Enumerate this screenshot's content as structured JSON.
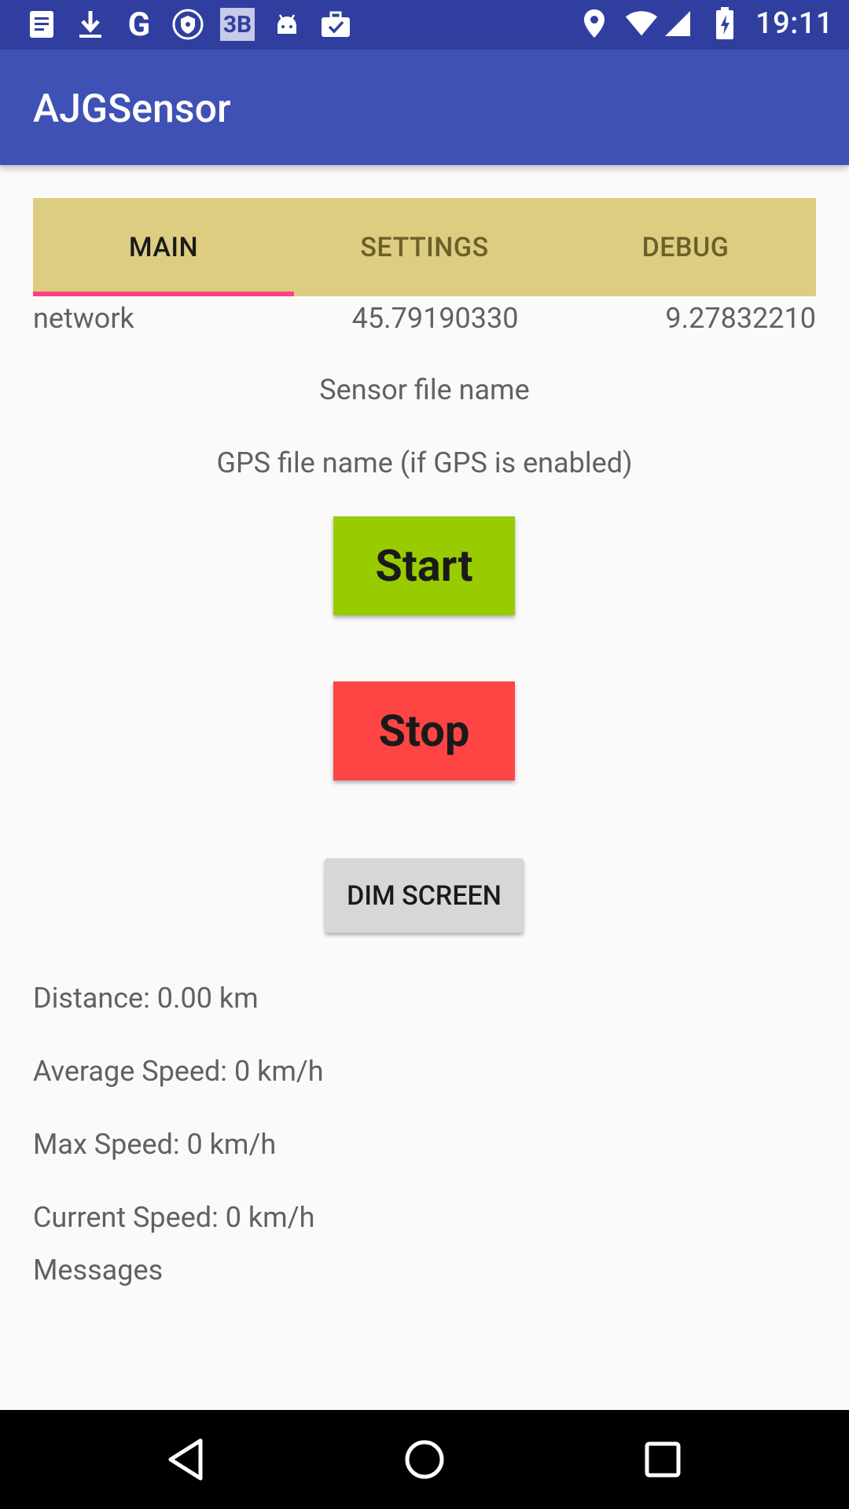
{
  "status_bar": {
    "time": "19:11",
    "left_icons": [
      "document-icon",
      "download-icon",
      "google-icon",
      "shield-icon",
      "bb-icon",
      "android-icon",
      "briefcase-check-icon"
    ],
    "right_icons": [
      "location-icon",
      "wifi-icon",
      "signal-icon",
      "battery-charging-icon"
    ],
    "g_glyph": "G",
    "bb_glyph": "3B"
  },
  "app_bar": {
    "title": "AJGSensor"
  },
  "tabs": [
    {
      "label": "MAIN",
      "active": true
    },
    {
      "label": "SETTINGS",
      "active": false
    },
    {
      "label": "DEBUG",
      "active": false
    }
  ],
  "location": {
    "provider": "network",
    "latitude": "45.79190330",
    "longitude": "9.27832210"
  },
  "main": {
    "sensor_file_label": "Sensor file name",
    "gps_file_label": "GPS file name (if GPS is enabled)",
    "start_label": "Start",
    "stop_label": "Stop",
    "dim_label": "DIM SCREEN"
  },
  "stats": {
    "distance": "Distance: 0.00 km",
    "avg_speed": "Average Speed: 0 km/h",
    "max_speed": "Max Speed: 0 km/h",
    "current_speed": "Current Speed: 0 km/h",
    "messages": "Messages"
  },
  "colors": {
    "status_bar": "#303f9f",
    "app_bar": "#3f51b5",
    "tab_bar": "#ddcd80",
    "tab_indicator": "#ff4081",
    "start": "#99cc00",
    "stop": "#ff4444",
    "dim": "#d6d7d7"
  }
}
